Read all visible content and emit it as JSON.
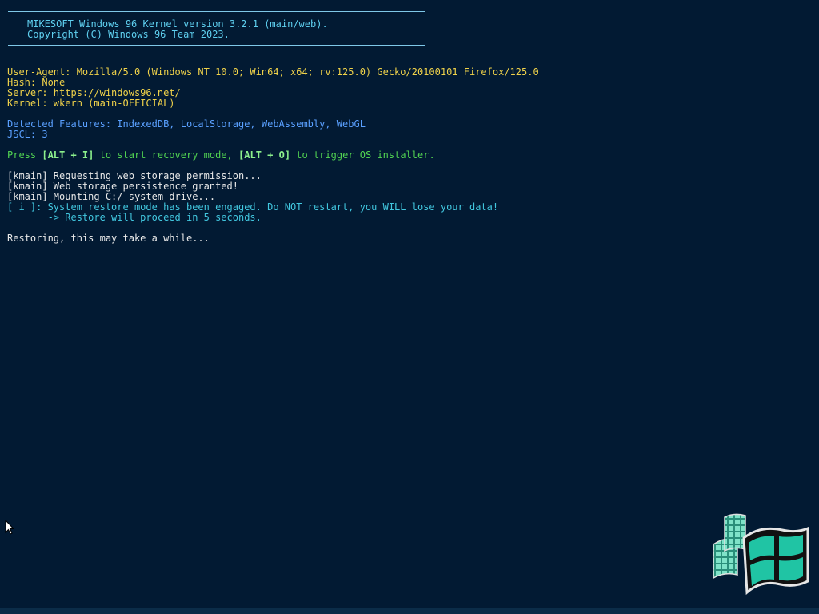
{
  "banner": {
    "line1": "MIKESOFT Windows 96 Kernel version 3.2.1 (main/web).",
    "line2": "Copyright (C) Windows 96 Team 2023."
  },
  "info": {
    "user_agent": "User-Agent: Mozilla/5.0 (Windows NT 10.0; Win64; x64; rv:125.0) Gecko/20100101 Firefox/125.0",
    "hash": "Hash: None",
    "server": "Server: https://windows96.net/",
    "kernel": "Kernel: wkern (main-OFFICIAL)"
  },
  "features": {
    "detected": "Detected Features: IndexedDB, LocalStorage, WebAssembly, WebGL",
    "jscl": "JSCL: 3"
  },
  "prompt": {
    "press": "Press ",
    "key1": "[ALT + I]",
    "mid": " to start recovery mode, ",
    "key2": "[ALT + O]",
    "end": " to trigger OS installer."
  },
  "log": {
    "line1": "[kmain] Requesting web storage permission...",
    "line2": "[kmain] Web storage persistence granted!",
    "line3": "[kmain] Mounting C:/ system drive...",
    "info1": "[ i ]: System restore mode has been engaged. Do NOT restart, you WILL lose your data!",
    "info2": "       -> Restore will proceed in 5 seconds."
  },
  "status": {
    "restoring": "Restoring, this may take a while..."
  },
  "icons": {
    "cursor": "mouse-pointer-icon",
    "logo": "windows96-logo"
  },
  "colors": {
    "background": "#021a33",
    "banner": "#5fd0f0",
    "info": "#f0d24a",
    "features": "#5aa0ff",
    "prompt": "#52d452",
    "log": "#e8e8e8",
    "notice": "#42c8e0"
  }
}
